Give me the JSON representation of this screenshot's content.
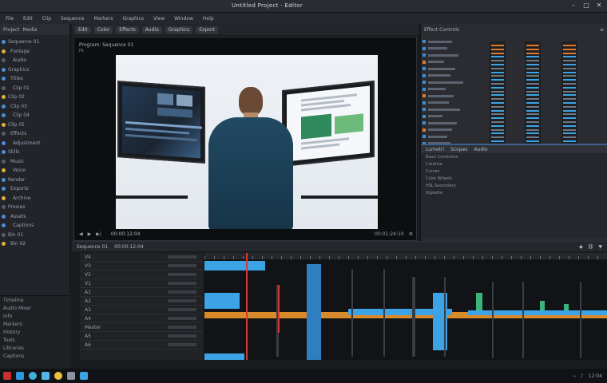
{
  "window": {
    "title": "Untitled Project - Editor"
  },
  "menubar": {
    "items": [
      "File",
      "Edit",
      "Clip",
      "Sequence",
      "Markers",
      "Graphics",
      "View",
      "Window",
      "Help"
    ]
  },
  "toolbar": {
    "items": [
      "Edit",
      "Color",
      "Effects",
      "Audio",
      "Graphics",
      "Export"
    ]
  },
  "left_panel": {
    "header": [
      "Project",
      "Media"
    ],
    "items": [
      "Sequence 01",
      "Footage",
      "Audio",
      "Graphics",
      "Titles",
      "Clip 01",
      "Clip 02",
      "Clip 03",
      "Clip 04",
      "Clip 05",
      "Effects",
      "Adjustment",
      "Stills",
      "Music",
      "Voice",
      "Render",
      "Exports",
      "Archive",
      "Proxies",
      "Assets",
      "Captions",
      "Bin 01",
      "Bin 02"
    ],
    "bottom": [
      "Timeline",
      "Audio Mixer",
      "Info",
      "Markers",
      "History",
      "Tools",
      "Libraries",
      "Captions"
    ]
  },
  "viewer": {
    "title": "Program: Sequence 01",
    "subtitle": "Fit",
    "timecode": "00:00:12:04",
    "duration": "00:01:24:10"
  },
  "right_panel": {
    "title": "Effect Controls",
    "sub_tabs": [
      "Lumetri",
      "Scopes",
      "Audio"
    ],
    "sub_rows": [
      "Basic Correction",
      "Creative",
      "Curves",
      "Color Wheels",
      "HSL Secondary",
      "Vignette"
    ]
  },
  "timeline": {
    "title": "Sequence 01",
    "timecode": "00:00:12:04",
    "tracks": [
      "V4",
      "V3",
      "V2",
      "V1",
      "A1",
      "A2",
      "A3",
      "A4",
      "Master",
      "A5",
      "A6"
    ]
  },
  "taskbar": {
    "time": "12:04"
  },
  "colors": {
    "accent": "#3ba3e6",
    "clip_orange": "#e07a2e",
    "playhead": "#d23a3a",
    "panel": "#222429"
  }
}
